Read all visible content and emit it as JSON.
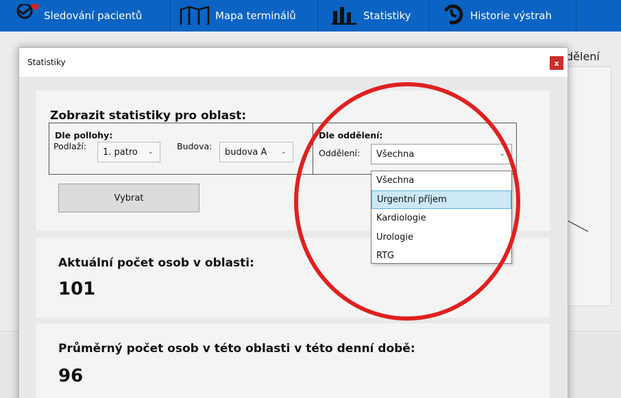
{
  "nav": {
    "items": [
      {
        "label": "Sledování pacientů",
        "icon": "patient-tracking-icon"
      },
      {
        "label": "Mapa terminálů",
        "icon": "map-icon"
      },
      {
        "label": "Statistiky",
        "icon": "bar-chart-icon"
      },
      {
        "label": "Historie výstrah",
        "icon": "history-icon"
      }
    ]
  },
  "background": {
    "section_fragment": "dělení"
  },
  "window": {
    "title": "Statistiky",
    "close_label": "x"
  },
  "area": {
    "heading": "Zobrazit statistiky pro oblast:",
    "location_group": {
      "title": "Dle pollohy:",
      "floor_label": "Podlaží:",
      "floor_value": "1. patro",
      "building_label": "Budova:",
      "building_value": "budova A"
    },
    "department_group": {
      "title": "Dle oddělení:",
      "department_label": "Oddělení:",
      "department_value": "Všechna"
    },
    "select_button": "Vybrat"
  },
  "dropdown": {
    "options": [
      "Všechna",
      "Urgentní příjem",
      "Kardiologie",
      "Urologie",
      "RTG"
    ],
    "highlighted": "Urgentní příjem"
  },
  "metrics": {
    "current_label": "Aktuální počet osob v oblasti:",
    "current_value": "101",
    "average_label": "Průměrný počet osob v této oblasti v této denní době:",
    "average_value": "96"
  },
  "colors": {
    "nav_bg": "#0b63c4",
    "annotation_circle": "#e02020",
    "highlight_bg": "#cce8f7",
    "close_bg": "#c9302c"
  }
}
